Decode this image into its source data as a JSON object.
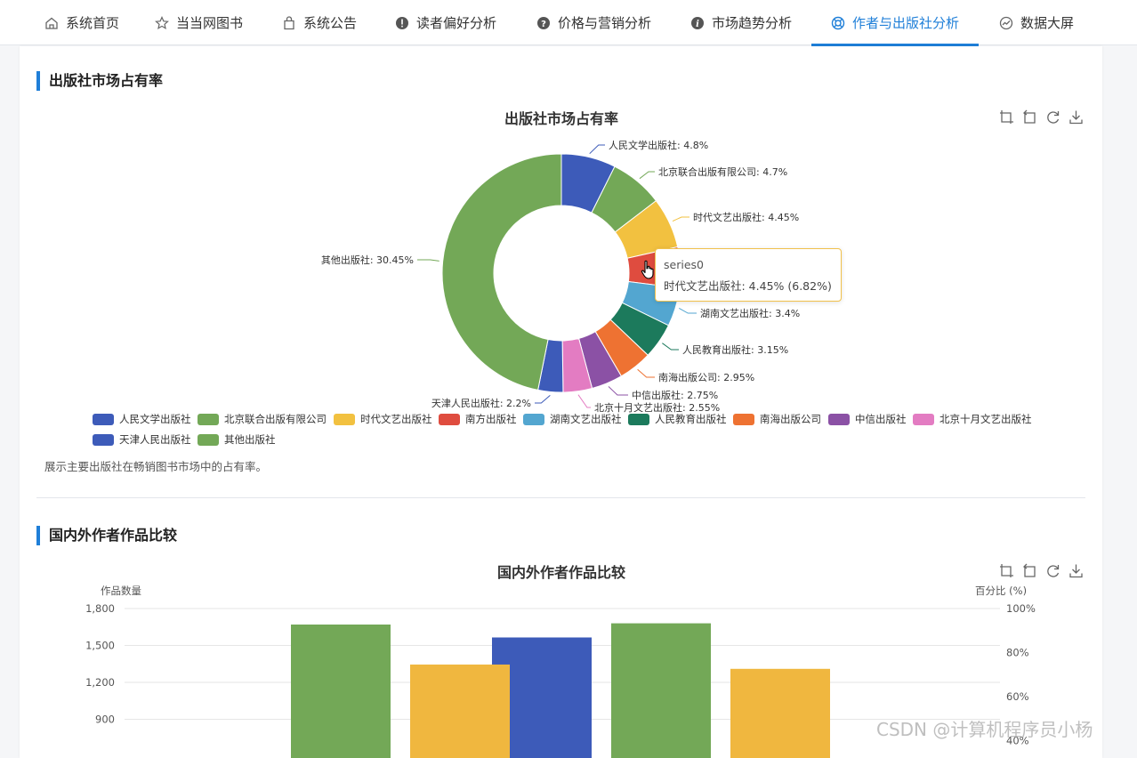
{
  "nav": {
    "items": [
      {
        "label": "系统首页",
        "icon": "home-icon"
      },
      {
        "label": "当当网图书",
        "icon": "star-icon"
      },
      {
        "label": "系统公告",
        "icon": "bag-icon"
      },
      {
        "label": "读者偏好分析",
        "icon": "alert-icon"
      },
      {
        "label": "价格与营销分析",
        "icon": "question-icon"
      },
      {
        "label": "市场趋势分析",
        "icon": "info-icon"
      },
      {
        "label": "作者与出版社分析",
        "icon": "lifebuoy-icon"
      },
      {
        "label": "数据大屏",
        "icon": "dashboard-icon"
      }
    ],
    "active_index": 6,
    "accent": "#1f7fd8"
  },
  "section1": {
    "title": "出版社市场占有率",
    "chart_title": "出版社市场占有率",
    "description": "展示主要出版社在畅销图书市场中的占有率。"
  },
  "section2": {
    "title": "国内外作者作品比较",
    "chart_title": "国内外作者作品比较",
    "left_axis_name": "作品数量",
    "right_axis_name": "百分比 (%)"
  },
  "tooltip": {
    "series": "series0",
    "body": "时代文艺出版社: 4.45% (6.82%)"
  },
  "watermark": "CSDN @计算机程序员小杨",
  "toolbox_icons": [
    "zoom-icon",
    "zoom-reset-icon",
    "restore-icon",
    "download-icon"
  ],
  "chart_data": [
    {
      "type": "pie",
      "title": "出版社市场占有率",
      "series_name": "series0",
      "slices": [
        {
          "name": "人民文学出版社",
          "value": 4.8,
          "label": "人民文学出版社: 4.8%",
          "color": "#3d5bb9"
        },
        {
          "name": "北京联合出版有限公司",
          "value": 4.7,
          "label": "北京联合出版有限公司: 4.7%",
          "color": "#73a857"
        },
        {
          "name": "时代文艺出版社",
          "value": 4.45,
          "label": "时代文艺出版社: 4.45%",
          "color": "#f2c140"
        },
        {
          "name": "南方出版社",
          "value": 3.6,
          "label": "",
          "color": "#df4c3f"
        },
        {
          "name": "湖南文艺出版社",
          "value": 3.4,
          "label": "湖南文艺出版社: 3.4%",
          "color": "#53a6d0"
        },
        {
          "name": "人民教育出版社",
          "value": 3.15,
          "label": "人民教育出版社: 3.15%",
          "color": "#1c7a5c"
        },
        {
          "name": "南海出版公司",
          "value": 2.95,
          "label": "南海出版公司: 2.95%",
          "color": "#ee7232"
        },
        {
          "name": "中信出版社",
          "value": 2.75,
          "label": "中信出版社: 2.75%",
          "color": "#8b51a5"
        },
        {
          "name": "北京十月文艺出版社",
          "value": 2.55,
          "label": "北京十月文艺出版社: 2.55%",
          "color": "#e37cc2"
        },
        {
          "name": "天津人民出版社",
          "value": 2.2,
          "label": "天津人民出版社: 2.2%",
          "color": "#3d5bb9"
        },
        {
          "name": "其他出版社",
          "value": 30.45,
          "label": "其他出版社: 30.45%",
          "color": "#73a857"
        }
      ],
      "legend": [
        "人民文学出版社",
        "北京联合出版有限公司",
        "时代文艺出版社",
        "南方出版社",
        "湖南文艺出版社",
        "人民教育出版社",
        "南海出版公司",
        "中信出版社",
        "北京十月文艺出版社",
        "天津人民出版社",
        "其他出版社"
      ]
    },
    {
      "type": "bar",
      "title": "国内外作者作品比较",
      "ylabel": "作品数量",
      "y2label": "百分比 (%)",
      "ylim": [
        0,
        1800
      ],
      "y_ticks": [
        "1,800",
        "1,500",
        "1,200",
        "900"
      ],
      "y_tick_values": [
        1800,
        1500,
        1200,
        900
      ],
      "y2_ticks": [
        "100%",
        "80%",
        "60%",
        "40%"
      ],
      "y2_tick_values": [
        100,
        80,
        60,
        40
      ],
      "series": [
        {
          "color": "#3d5bb9",
          "values": [
            null,
            1565
          ]
        },
        {
          "color": "#73a857",
          "values": [
            1670,
            1680
          ]
        },
        {
          "color": "#f0b73f",
          "values": [
            1345,
            1310
          ]
        }
      ]
    }
  ]
}
